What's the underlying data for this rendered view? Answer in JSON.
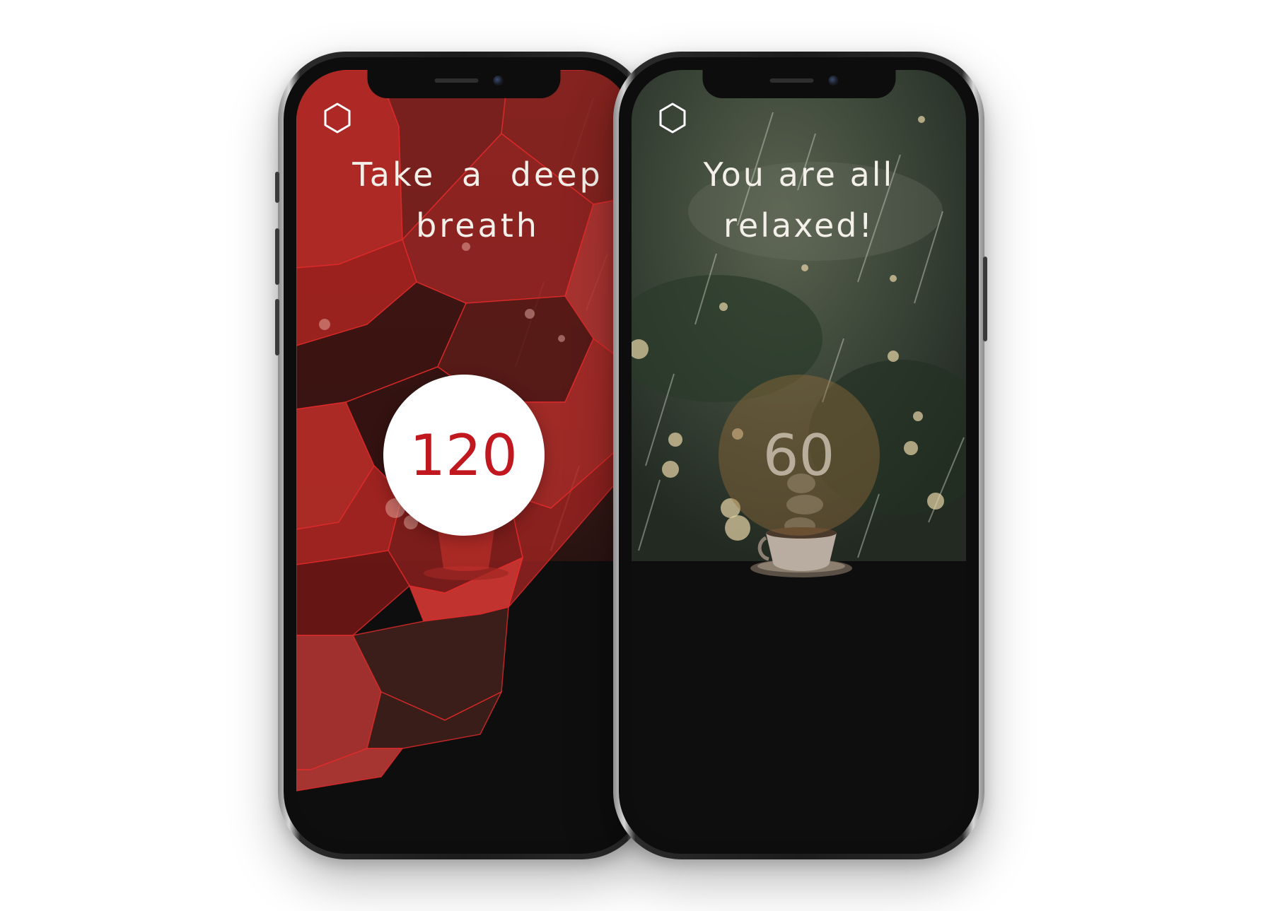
{
  "screens": [
    {
      "id": "left",
      "icon": "hexagon-icon",
      "headline_lines": [
        "Take a deep",
        "breath"
      ],
      "counter": "120",
      "state": "breathing"
    },
    {
      "id": "right",
      "icon": "hexagon-icon",
      "headline_lines": [
        "You are all",
        "relaxed!"
      ],
      "counter": "60",
      "state": "relaxed"
    }
  ],
  "colors": {
    "accent_red": "#c1171f",
    "poly_red": "#b3201f",
    "rain_green": "#39443a",
    "floor": "#0e0e0e",
    "text": "#f3efe9"
  }
}
